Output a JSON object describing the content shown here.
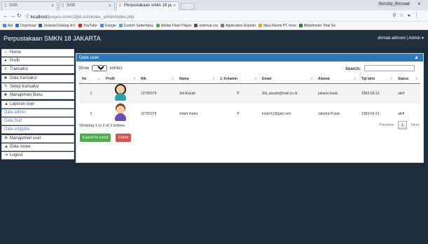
{
  "browser": {
    "tabs": [
      {
        "label": "SAB",
        "active": false
      },
      {
        "label": "SAB",
        "active": false
      },
      {
        "label": "Perpustakaan smkn 18 ja",
        "active": true
      }
    ],
    "window_user": "Bossby_Bossed",
    "url_host": "localhost",
    "url_path": "/perpus-smkn18jkt-ash/index_admin/index.php",
    "bookmarks": [
      {
        "label": "Apl",
        "color": "#4285f4"
      },
      {
        "label": "Download",
        "color": "#1a73e8"
      },
      {
        "label": "Selamat Datang di F",
        "color": "#3b5998"
      },
      {
        "label": "YouTube",
        "color": "#e62117"
      },
      {
        "label": "Google",
        "color": "#4285f4"
      },
      {
        "label": "Contoh Sederhana",
        "color": "#5b9bd5"
      },
      {
        "label": "Adobe Flash Player",
        "color": "#4caf50"
      },
      {
        "label": "external.css",
        "color": "#555555"
      },
      {
        "label": "Application Expirati",
        "color": "#777777"
      },
      {
        "label": "Situs Resmi PT. Kere",
        "color": "#e6a23c"
      },
      {
        "label": "Bitdefender Total Se",
        "color": "#2e7d32"
      }
    ]
  },
  "app": {
    "title": "Perpustakaan SMKN 18 JAKARTA",
    "user_menu": "ahmad akhroni | Admin"
  },
  "sidebar": {
    "items": [
      {
        "label": "Home",
        "icon": "home-icon",
        "glyph": "⌂",
        "sub": false
      },
      {
        "label": "Profil",
        "icon": "user-icon",
        "glyph": "●",
        "sub": false
      },
      {
        "label": "Transaksi",
        "icon": "list-icon",
        "glyph": "≡",
        "sub": false
      },
      {
        "label": "Data transaksi",
        "icon": "book-icon",
        "glyph": "■",
        "sub": false
      },
      {
        "label": "Setup transaksi",
        "icon": "edit-icon",
        "glyph": "✎",
        "sub": false
      },
      {
        "label": "Manajemen Buku",
        "icon": "book-icon",
        "glyph": "■",
        "sub": false
      },
      {
        "label": "Laporan user",
        "icon": "chart-icon",
        "glyph": "▲",
        "sub": false
      },
      {
        "label": "Data admin",
        "icon": "",
        "glyph": "",
        "sub": true
      },
      {
        "label": "Data Staf",
        "icon": "",
        "glyph": "",
        "sub": true
      },
      {
        "label": "Data anggota",
        "icon": "",
        "glyph": "",
        "sub": true
      },
      {
        "label": "Manajemen user",
        "icon": "gear-icon",
        "glyph": "✲",
        "sub": false
      },
      {
        "label": "Data siswa",
        "icon": "user-icon",
        "glyph": "▲",
        "sub": false
      },
      {
        "label": "Logout",
        "icon": "logout-icon",
        "glyph": "⇥",
        "sub": false
      }
    ]
  },
  "panel": {
    "title": "Data user",
    "show_label": "Show",
    "entries_value": "10",
    "entries_label": "entries",
    "search_label": "Search:",
    "columns": [
      "No",
      "Profil",
      "Nik",
      "Nama",
      "J. Kelamin",
      "Email",
      "Alamat",
      "Tgl lahir",
      "Status"
    ],
    "rows": [
      {
        "no": "1",
        "avatar": "female",
        "nik": "12765379",
        "nama": "Siti Aisyah",
        "jk": "P",
        "email": "Siti_aisyah@mail.co.id",
        "alamat": "jakarta barat",
        "tgl": "1993-03-12",
        "status": "aktif"
      },
      {
        "no": "2",
        "avatar": "male",
        "nik": "12765379",
        "nama": "indah maria",
        "jk": "P",
        "email": "indah12@gail.com",
        "alamat": "Jakarta Pusat",
        "tgl": "1993-03-21",
        "status": "aktif"
      }
    ],
    "info": "Showing 1 to 2 of 2 entries",
    "pager": {
      "previous": "Previous",
      "page": "1",
      "next": "Next"
    },
    "export_label": "Export to excel",
    "print_label": "Cetak"
  },
  "colors": {
    "header_bg": "#212f3c",
    "panel_head": "#2f79b9",
    "excel_btn": "#4cae4c",
    "print_btn": "#d9534f",
    "female_hair": "#1b1b1b",
    "female_body": "#2aa2a6",
    "male_hair": "#7a3f1d",
    "male_body": "#6a4fb3"
  }
}
